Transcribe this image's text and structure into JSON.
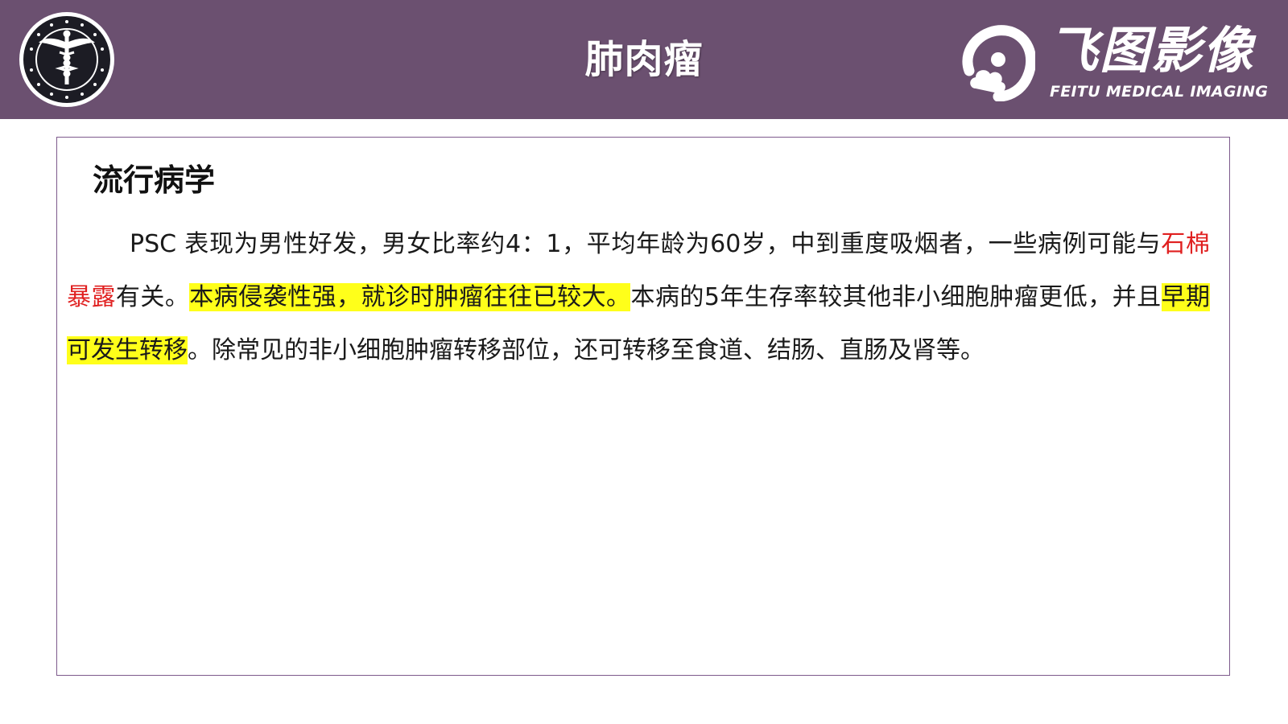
{
  "header": {
    "title": "肺肉瘤",
    "brand_name": "飞图影像",
    "brand_subtitle": "FEITU MEDICAL IMAGING",
    "left_logo_icon": "caduceus-seal-icon",
    "brand_icon": "feitu-cloud-icon",
    "colors": {
      "header_bg": "#6b5070",
      "text": "#ffffff"
    }
  },
  "section": {
    "heading": "流行病学",
    "paragraph": {
      "seg1": "PSC 表现为男性好发，男女比率约4：1，平均年龄为60岁，中到重度吸烟者，一些病例可能与",
      "red1": "石棉暴露",
      "seg2": "有关。",
      "hl1": "本病侵袭性强，就诊时肿瘤往往已较大。",
      "seg3": "本病的5年生存率较其他非小细胞肿瘤更低，并且",
      "hl2": "早期可发生转移",
      "seg4": "。除常见的非小细胞肿瘤转移部位，还可转移至食道、结肠、直肠及肾等。"
    },
    "colors": {
      "red_text": "#e02020",
      "highlight": "#ffff1a",
      "border": "#7d5a8c"
    }
  }
}
